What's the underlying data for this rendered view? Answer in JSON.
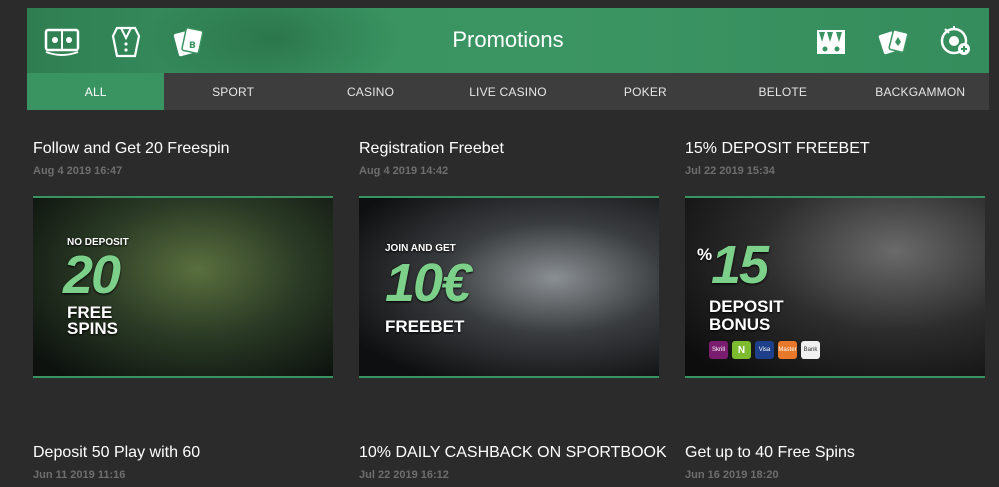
{
  "header": {
    "title": "Promotions",
    "accent": "#3a9462",
    "icons_left": [
      "sports-book-icon",
      "casino-dealer-icon",
      "cards-icon"
    ],
    "icons_right": [
      "backgammon-board-icon",
      "poker-cards-icon",
      "lottery-icon"
    ]
  },
  "tabs": [
    {
      "label": "ALL",
      "active": true
    },
    {
      "label": "SPORT",
      "active": false
    },
    {
      "label": "CASINO",
      "active": false
    },
    {
      "label": "LIVE CASINO",
      "active": false
    },
    {
      "label": "POKER",
      "active": false
    },
    {
      "label": "BELOTE",
      "active": false
    },
    {
      "label": "BACKGAMMON",
      "active": false
    }
  ],
  "promotions": [
    {
      "title": "Follow and Get 20 Freespin",
      "date": "Aug 4 2019 16:47",
      "banner": {
        "line1": "NO DEPOSIT",
        "big": "20",
        "line2": "FREE",
        "line3": "SPINS"
      }
    },
    {
      "title": "Registration Freebet",
      "date": "Aug 4 2019 14:42",
      "banner": {
        "line1": "JOIN AND GET",
        "big": "10€",
        "line2": "FREEBET"
      }
    },
    {
      "title": "15% DEPOSIT FREEBET",
      "date": "Jul 22 2019 15:34",
      "banner": {
        "line1": "%",
        "big": "15",
        "line2": "DEPOSIT",
        "line3": "BONUS",
        "payments": [
          "Skrill",
          "N",
          "Visa",
          "Master",
          "Bank"
        ]
      }
    },
    {
      "title": "Deposit 50 Play with 60",
      "date": "Jun 11 2019 11:16"
    },
    {
      "title": "10% DAILY CASHBACK ON SPORTBOOK",
      "date": "Jul 22 2019 16:12"
    },
    {
      "title": "Get up to 40 Free Spins",
      "date": "Jun 16 2019 18:20"
    }
  ]
}
